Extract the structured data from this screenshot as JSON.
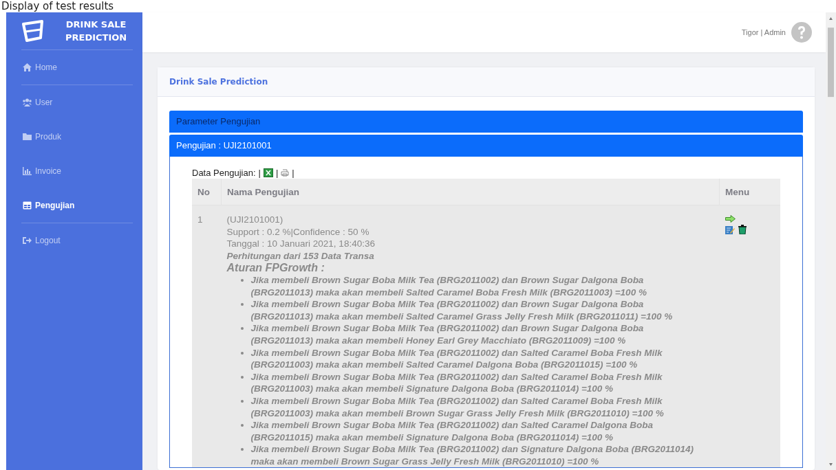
{
  "caption": "Display of test results",
  "sidebar": {
    "brand": [
      "DRINK SALE",
      "PREDICTION"
    ],
    "items": [
      {
        "label": "Home",
        "kind": "home",
        "selected": false,
        "divider": true
      },
      {
        "label": "User",
        "kind": "users",
        "selected": false,
        "divider": false
      },
      {
        "label": "Produk",
        "kind": "folder",
        "selected": false,
        "divider": false
      },
      {
        "label": "Invoice",
        "kind": "chart",
        "selected": false,
        "divider": false
      },
      {
        "label": "Pengujian",
        "kind": "table",
        "selected": true,
        "divider": true
      },
      {
        "label": "Logout",
        "kind": "logout",
        "selected": false,
        "divider": false
      }
    ]
  },
  "topbar": {
    "user": "Tigor | Admin"
  },
  "card": {
    "title": "Drink Sale Prediction",
    "panels": [
      {
        "label": "Parameter Pengujian",
        "expanded": false
      },
      {
        "label": "Pengujian : UJI2101001",
        "expanded": true
      }
    ]
  },
  "data_label": "Data Pengujian:",
  "separator": "|",
  "table": {
    "columns": [
      "No",
      "Nama Pengujian",
      "Menu"
    ],
    "rows": [
      {
        "no": "1",
        "code": "(UJI2101001)",
        "params": "Support : 0.2 %|Confidence : 50 %",
        "date": "Tanggal : 10 Januari 2021, 18:40:36",
        "note": "Perhitungan dari 153 Data Transa",
        "rules_title": "Aturan FPGrowth :",
        "rules": [
          "Jika membeli Brown Sugar Boba Milk Tea (BRG2011002) dan Brown Sugar Dalgona Boba (BRG2011013) maka akan membeli Salted Caramel Boba Fresh Milk (BRG2011003) =100 %",
          "Jika membeli Brown Sugar Boba Milk Tea (BRG2011002) dan Brown Sugar Dalgona Boba (BRG2011013) maka akan membeli Salted Caramel Grass Jelly Fresh Milk (BRG2011011) =100 %",
          "Jika membeli Brown Sugar Boba Milk Tea (BRG2011002) dan Brown Sugar Dalgona Boba (BRG2011013) maka akan membeli Honey Earl Grey Macchiato (BRG2011009) =100 %",
          "Jika membeli Brown Sugar Boba Milk Tea (BRG2011002) dan Salted Caramel Boba Fresh Milk (BRG2011003) maka akan membeli Salted Caramel Dalgona Boba (BRG2011015) =100 %",
          "Jika membeli Brown Sugar Boba Milk Tea (BRG2011002) dan Salted Caramel Boba Fresh Milk (BRG2011003) maka akan membeli Signature Dalgona Boba (BRG2011014) =100 %",
          "Jika membeli Brown Sugar Boba Milk Tea (BRG2011002) dan Salted Caramel Boba Fresh Milk (BRG2011003) maka akan membeli Brown Sugar Grass Jelly Fresh Milk (BRG2011010) =100 %",
          "Jika membeli Brown Sugar Boba Milk Tea (BRG2011002) dan Salted Caramel Dalgona Boba (BRG2011015) maka akan membeli Signature Dalgona Boba (BRG2011014) =100 %",
          "Jika membeli Brown Sugar Boba Milk Tea (BRG2011002) dan Signature Dalgona Boba (BRG2011014) maka akan membeli Brown Sugar Grass Jelly Fresh Milk (BRG2011010) =100 %"
        ]
      }
    ]
  }
}
